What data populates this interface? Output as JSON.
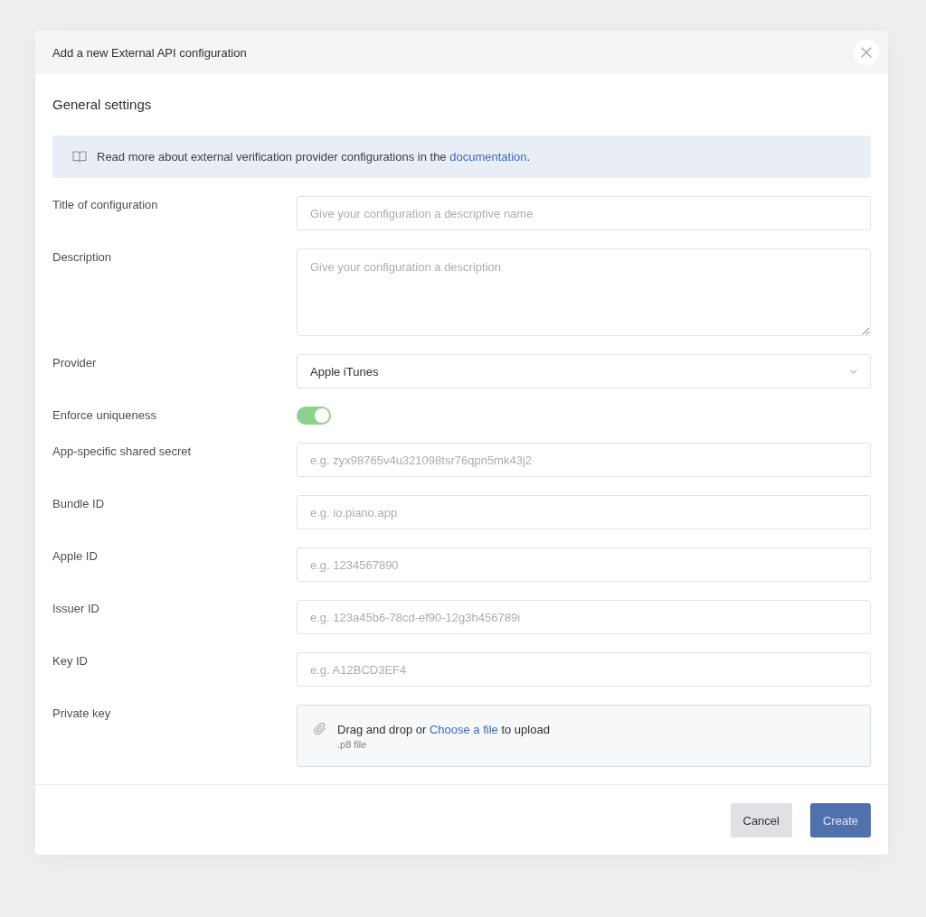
{
  "dialog": {
    "title": "Add a new External API configuration"
  },
  "section": {
    "heading": "General settings"
  },
  "notice": {
    "text": "Read more about external verification provider configurations in the",
    "link": "documentation",
    "after": "."
  },
  "fields": [
    {
      "kind": "text",
      "label": "Title of configuration",
      "placeholder": "Give your configuration a descriptive name"
    },
    {
      "kind": "textarea",
      "label": "Description",
      "placeholder": "Give your configuration a description"
    },
    {
      "kind": "select",
      "label": "Provider",
      "value": "Apple iTunes"
    },
    {
      "kind": "toggle",
      "label": "Enforce uniqueness",
      "on": true
    },
    {
      "kind": "text",
      "label": "App-specific shared secret",
      "placeholder": "e.g. zyx98765v4u321098tsr76qpn5mk43j2"
    },
    {
      "kind": "text",
      "label": "Bundle ID",
      "placeholder": "e.g. io.piano.app"
    },
    {
      "kind": "text",
      "label": "Apple ID",
      "placeholder": "e.g. 1234567890"
    },
    {
      "kind": "text",
      "label": "Issuer ID",
      "placeholder": "e.g. 123a45b6-78cd-ef90-12g3h456789i"
    },
    {
      "kind": "text",
      "label": "Key ID",
      "placeholder": "e.g. A12BCD3EF4"
    },
    {
      "kind": "file",
      "label": "Private key",
      "prompt": "Drag and drop or",
      "link": "Choose a file",
      "after": "to upload",
      "hint": ".p8 file"
    }
  ],
  "buttons": [
    {
      "kind": "secondary",
      "label": "Cancel"
    },
    {
      "kind": "primary",
      "label": "Create"
    }
  ]
}
